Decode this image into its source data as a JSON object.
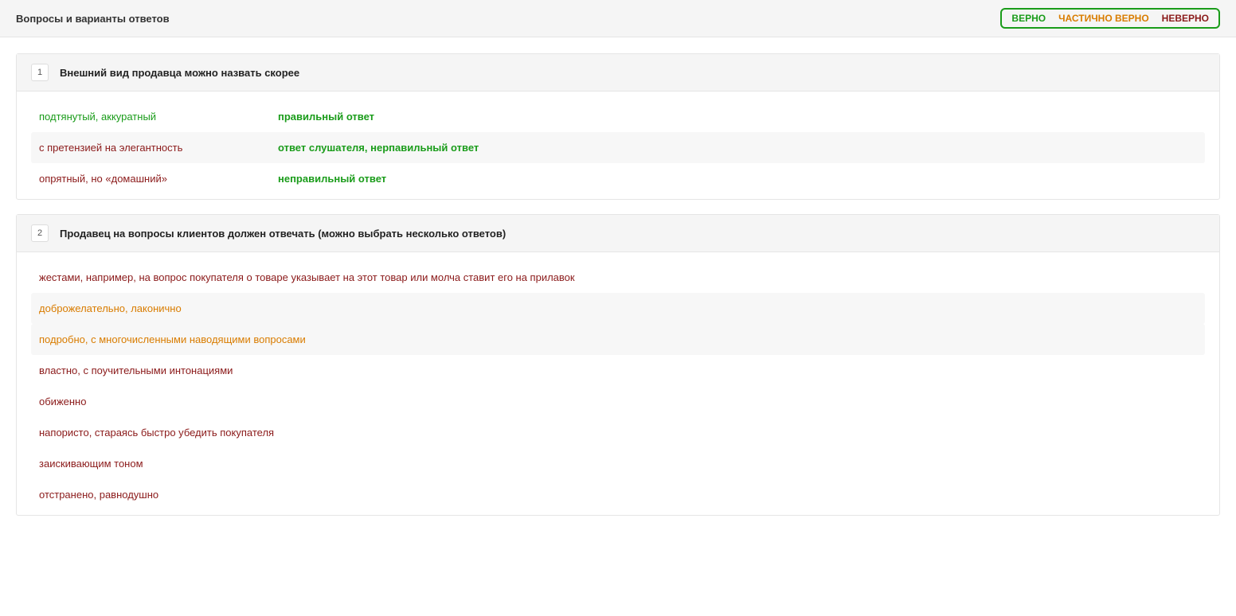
{
  "header": {
    "title": "Вопросы и варианты ответов",
    "legend": {
      "correct": "ВЕРНО",
      "partial": "ЧАСТИЧНО ВЕРНО",
      "wrong": "НЕВЕРНО"
    }
  },
  "questions": [
    {
      "num": "1",
      "text": "Внешний вид продавца можно назвать скорее",
      "answers": [
        {
          "text": "подтянутый, аккуратный",
          "status": "correct",
          "note": "правильный ответ",
          "striped": false
        },
        {
          "text": "с претензией на элегантность",
          "status": "wrong",
          "note": "ответ слушателя, нерпавильный ответ",
          "striped": true
        },
        {
          "text": "опрятный, но «домашний»",
          "status": "wrong",
          "note": "неправильный ответ",
          "striped": false
        }
      ]
    },
    {
      "num": "2",
      "text": "Продавец на вопросы клиентов должен отвечать (можно выбрать несколько ответов)",
      "answers": [
        {
          "text": "жестами, например, на вопрос покупателя о товаре указывает на этот товар или молча ставит его на прилавок",
          "status": "wrong",
          "note": "",
          "striped": false
        },
        {
          "text": "доброжелательно, лаконично",
          "status": "partial",
          "note": "",
          "striped": true
        },
        {
          "text": "подробно, с многочисленными наводящими вопросами",
          "status": "partial",
          "note": "",
          "striped": true
        },
        {
          "text": "властно, с поучительными интонациями",
          "status": "wrong",
          "note": "",
          "striped": false
        },
        {
          "text": "обиженно",
          "status": "wrong",
          "note": "",
          "striped": false
        },
        {
          "text": "напористо, стараясь быстро убедить покупателя",
          "status": "wrong",
          "note": "",
          "striped": false
        },
        {
          "text": "заискивающим тоном",
          "status": "wrong",
          "note": "",
          "striped": false
        },
        {
          "text": "отстранено, равнодушно",
          "status": "wrong",
          "note": "",
          "striped": false
        }
      ]
    }
  ]
}
